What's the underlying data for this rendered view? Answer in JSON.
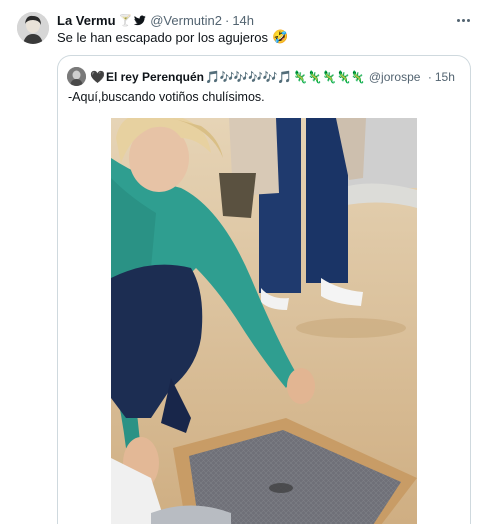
{
  "tweet": {
    "author_name": "La Vermu",
    "author_emoji": "🍸",
    "platform_icon": "twitter-bird-icon",
    "handle": "@Vermutin2",
    "separator": "·",
    "time": "14h",
    "text": "Se le han escapado por los agujeros",
    "text_emoji": "🤣",
    "more_icon": "more-icon"
  },
  "quote": {
    "heart": "🖤",
    "author_name": "El rey Perenquén",
    "emojis_music": "🎵🎶🎶🎶🎶🎵",
    "emojis_lizards": "🦎🦎🦎🦎🦎",
    "handle": "@jorospe",
    "separator": "·",
    "time": "15h",
    "text": "-Aquí,buscando votiños chulísimos."
  },
  "colors": {
    "text_primary": "#0f1419",
    "text_secondary": "#536471",
    "border": "#cfd9de",
    "twitter_blue": "#1d9bf0",
    "sweater_teal": "#2f9e90",
    "sand": "#d9bf9b"
  }
}
